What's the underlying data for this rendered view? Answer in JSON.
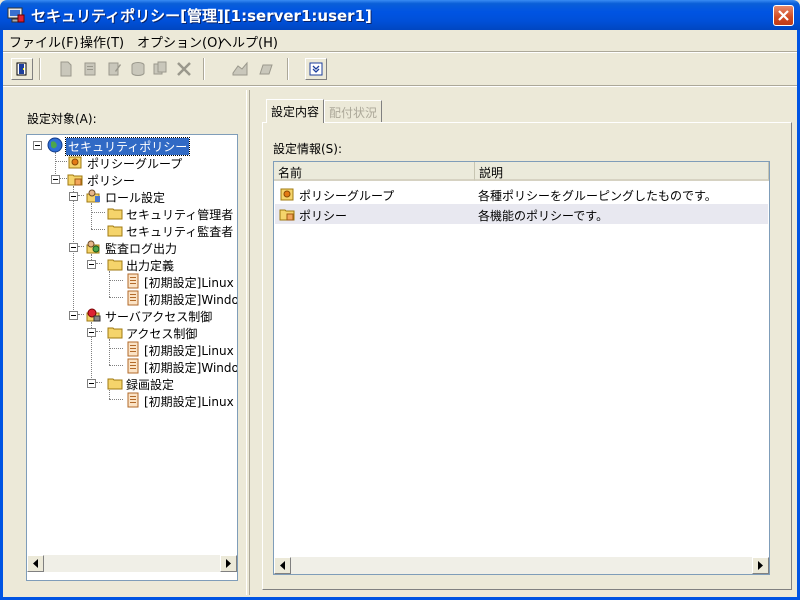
{
  "window": {
    "title": "セキュリティポリシー[管理][1:server1:user1]"
  },
  "menu": [
    {
      "label": "ファイル(F)"
    },
    {
      "label": "操作(T)"
    },
    {
      "label": "オプション(O)"
    },
    {
      "label": "ヘルプ(H)"
    }
  ],
  "left": {
    "label": "設定対象(A):",
    "tree": [
      {
        "label": "セキュリティポリシー",
        "icon": "globe-icon"
      },
      {
        "label": "ポリシーグループ",
        "icon": "policy-group-icon"
      },
      {
        "label": "ポリシー",
        "icon": "policy-icon"
      },
      {
        "label": "ロール設定",
        "icon": "role-icon"
      },
      {
        "label": "セキュリティ管理者",
        "icon": "folder-icon"
      },
      {
        "label": "セキュリティ監査者",
        "icon": "folder-icon"
      },
      {
        "label": "監査ログ出力",
        "icon": "audit-log-icon"
      },
      {
        "label": "出力定義",
        "icon": "folder-icon"
      },
      {
        "label": "[初期設定]Linux",
        "icon": "document-icon"
      },
      {
        "label": "[初期設定]Windo",
        "icon": "document-icon"
      },
      {
        "label": "サーバアクセス制御",
        "icon": "access-control-icon"
      },
      {
        "label": "アクセス制御",
        "icon": "folder-icon"
      },
      {
        "label": "[初期設定]Linux",
        "icon": "document-icon"
      },
      {
        "label": "[初期設定]Windo",
        "icon": "document-icon"
      },
      {
        "label": "録画設定",
        "icon": "folder-icon"
      },
      {
        "label": "[初期設定]Linux",
        "icon": "document-icon"
      }
    ]
  },
  "right": {
    "tabs": [
      {
        "label": "設定内容"
      },
      {
        "label": "配付状況"
      }
    ],
    "info_label": "設定情報(S):",
    "columns": [
      "名前",
      "説明"
    ],
    "rows": [
      {
        "name": "ポリシーグループ",
        "description": "各種ポリシーをグルーピングしたものです。",
        "icon": "policy-group-icon"
      },
      {
        "name": "ポリシー",
        "description": "各機能のポリシーです。",
        "icon": "policy-icon"
      }
    ]
  },
  "colors": {
    "titlebar": "#0054e3",
    "selection": "#316ac5",
    "folder": "#f5d46b",
    "alt_row": "#e8e8f0"
  }
}
